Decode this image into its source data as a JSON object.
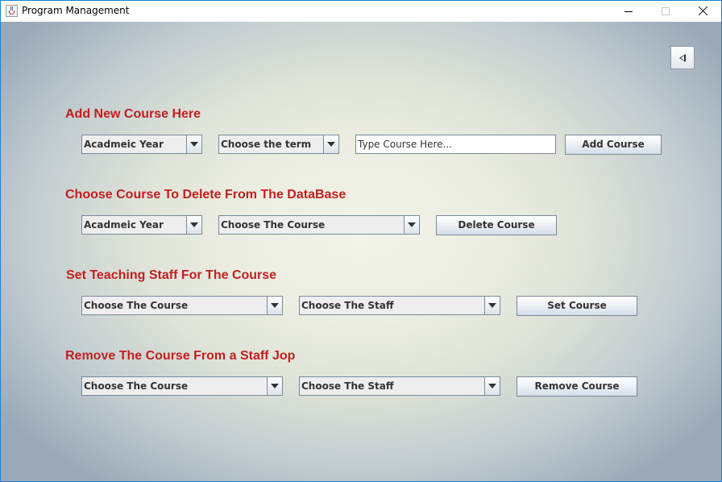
{
  "window": {
    "title": "Program Management"
  },
  "sections": {
    "add": {
      "heading": "Add New Course Here",
      "year_combo": "Acadmeic Year",
      "term_combo": "Choose the term",
      "course_input_placeholder": "Type Course Here...",
      "button": "Add Course"
    },
    "delete": {
      "heading": "Choose Course To Delete From The DataBase",
      "year_combo": "Acadmeic Year",
      "course_combo": "Choose The Course",
      "button": "Delete Course"
    },
    "set_staff": {
      "heading": "Set Teaching Staff For The Course",
      "course_combo": "Choose The Course",
      "staff_combo": "Choose The Staff",
      "button": "Set Course"
    },
    "remove_staff": {
      "heading": "Remove The Course From a Staff Jop",
      "course_combo": "Choose The Course",
      "staff_combo": "Choose The Staff",
      "button": "Remove Course"
    }
  },
  "icons": {
    "app": "java-cup-icon",
    "back": "triangle-left-icon",
    "dropdown": "chevron-down-icon"
  },
  "colors": {
    "heading": "#c21f1f",
    "window_border": "#1883d7",
    "control_border": "#7a8a99"
  }
}
